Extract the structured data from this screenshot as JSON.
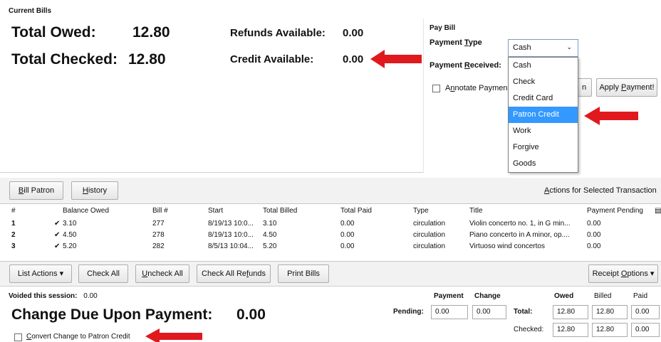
{
  "current_bills": {
    "section_title": "Current Bills",
    "total_owed_label": "Total Owed:",
    "total_owed_value": "12.80",
    "total_checked_label": "Total Checked:",
    "total_checked_value": "12.80",
    "refunds_label": "Refunds Available:",
    "refunds_value": "0.00",
    "credit_label": "Credit Available:",
    "credit_value": "0.00"
  },
  "pay_bill": {
    "title": "Pay Bill",
    "payment_type_label_pre": "Payment ",
    "payment_type_label_ul": "T",
    "payment_type_label_post": "ype",
    "payment_type_selected": "Cash",
    "payment_received_label_pre": "Payment ",
    "payment_received_label_ul": "R",
    "payment_received_label_post": "eceived:",
    "annotate_label_pre": "A",
    "annotate_label_ul": "n",
    "annotate_label_post": "notate Paymen",
    "partial_button_text": "n",
    "apply_label_pre": "Apply ",
    "apply_label_ul": "P",
    "apply_label_post": "ayment!",
    "options": [
      "Cash",
      "Check",
      "Credit Card",
      "Patron Credit",
      "Work",
      "Forgive",
      "Goods"
    ],
    "highlighted_option": "Patron Credit"
  },
  "toolbar": {
    "bill_patron_ul": "B",
    "bill_patron_rest": "ill Patron",
    "history_ul": "H",
    "history_rest": "istory",
    "actions_ul": "A",
    "actions_rest": "ctions for Selected Transaction"
  },
  "grid": {
    "columns": [
      "#",
      "Balance Owed",
      "Bill #",
      "Start",
      "Total Billed",
      "Total Paid",
      "Type",
      "Title",
      "Payment Pending"
    ],
    "rows": [
      {
        "num": "1",
        "check": "✔",
        "balance": "3.10",
        "bill": "277",
        "start": "8/19/13 10:0...",
        "billed": "3.10",
        "paid": "0.00",
        "type": "circulation",
        "title": "Violin concerto no. 1, in G min...",
        "pending": "0.00"
      },
      {
        "num": "2",
        "check": "✔",
        "balance": "4.50",
        "bill": "278",
        "start": "8/19/13 10:0...",
        "billed": "4.50",
        "paid": "0.00",
        "type": "circulation",
        "title": "Piano concerto in A minor, op....",
        "pending": "0.00"
      },
      {
        "num": "3",
        "check": "✔",
        "balance": "5.20",
        "bill": "282",
        "start": "8/5/13 10:04...",
        "billed": "5.20",
        "paid": "0.00",
        "type": "circulation",
        "title": "Virtuoso wind concertos",
        "pending": "0.00"
      }
    ]
  },
  "bottom_toolbar": {
    "list_actions": "List Actions",
    "check_all": "Check All",
    "uncheck_all_ul": "U",
    "uncheck_all_rest": "ncheck All",
    "check_all_refunds_pre": "Check All Re",
    "check_all_refunds_ul": "f",
    "check_all_refunds_post": "unds",
    "print_bills": "Print Bills",
    "receipt_pre": "Receipt ",
    "receipt_ul": "O",
    "receipt_post": "ptions"
  },
  "footer": {
    "voided_label": "Voided this session:",
    "voided_value": "0.00",
    "change_due_label": "Change Due Upon Payment:",
    "change_due_value": "0.00",
    "convert_ul": "C",
    "convert_rest": "onvert Change to Patron Credit",
    "payment_header": "Payment",
    "change_header": "Change",
    "owed_header": "Owed",
    "billed_header": "Billed",
    "paid_header": "Paid",
    "pending_label": "Pending:",
    "pending_payment": "0.00",
    "pending_change": "0.00",
    "total_label": "Total:",
    "total_owed": "12.80",
    "total_billed": "12.80",
    "total_paid": "0.00",
    "checked_label": "Checked:",
    "checked_owed": "12.80",
    "checked_billed": "12.80",
    "checked_paid": "0.00"
  },
  "colors": {
    "arrow": "#e0191e",
    "selection": "#3399ff"
  }
}
